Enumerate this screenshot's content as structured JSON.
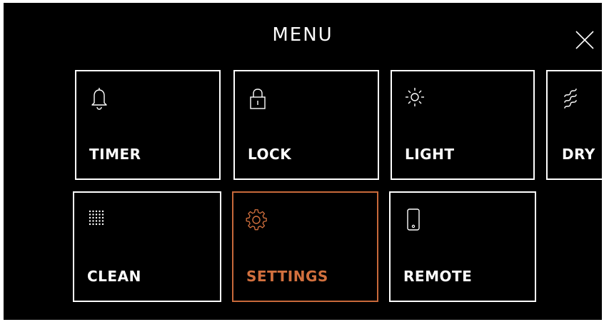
{
  "header": {
    "title": "MENU",
    "close_icon": "close-icon"
  },
  "colors": {
    "background": "#000000",
    "text": "#ffffff",
    "active": "#d2703e"
  },
  "tiles": [
    {
      "label": "TIMER",
      "icon": "bell-icon",
      "active": false
    },
    {
      "label": "LOCK",
      "icon": "padlock-icon",
      "active": false
    },
    {
      "label": "LIGHT",
      "icon": "sun-icon",
      "active": false
    },
    {
      "label": "DRY",
      "icon": "waves-icon",
      "active": false
    },
    {
      "label": "CLEAN",
      "icon": "dot-grid-icon",
      "active": false
    },
    {
      "label": "SETTINGS",
      "icon": "gear-icon",
      "active": true
    },
    {
      "label": "REMOTE",
      "icon": "phone-icon",
      "active": false
    }
  ]
}
